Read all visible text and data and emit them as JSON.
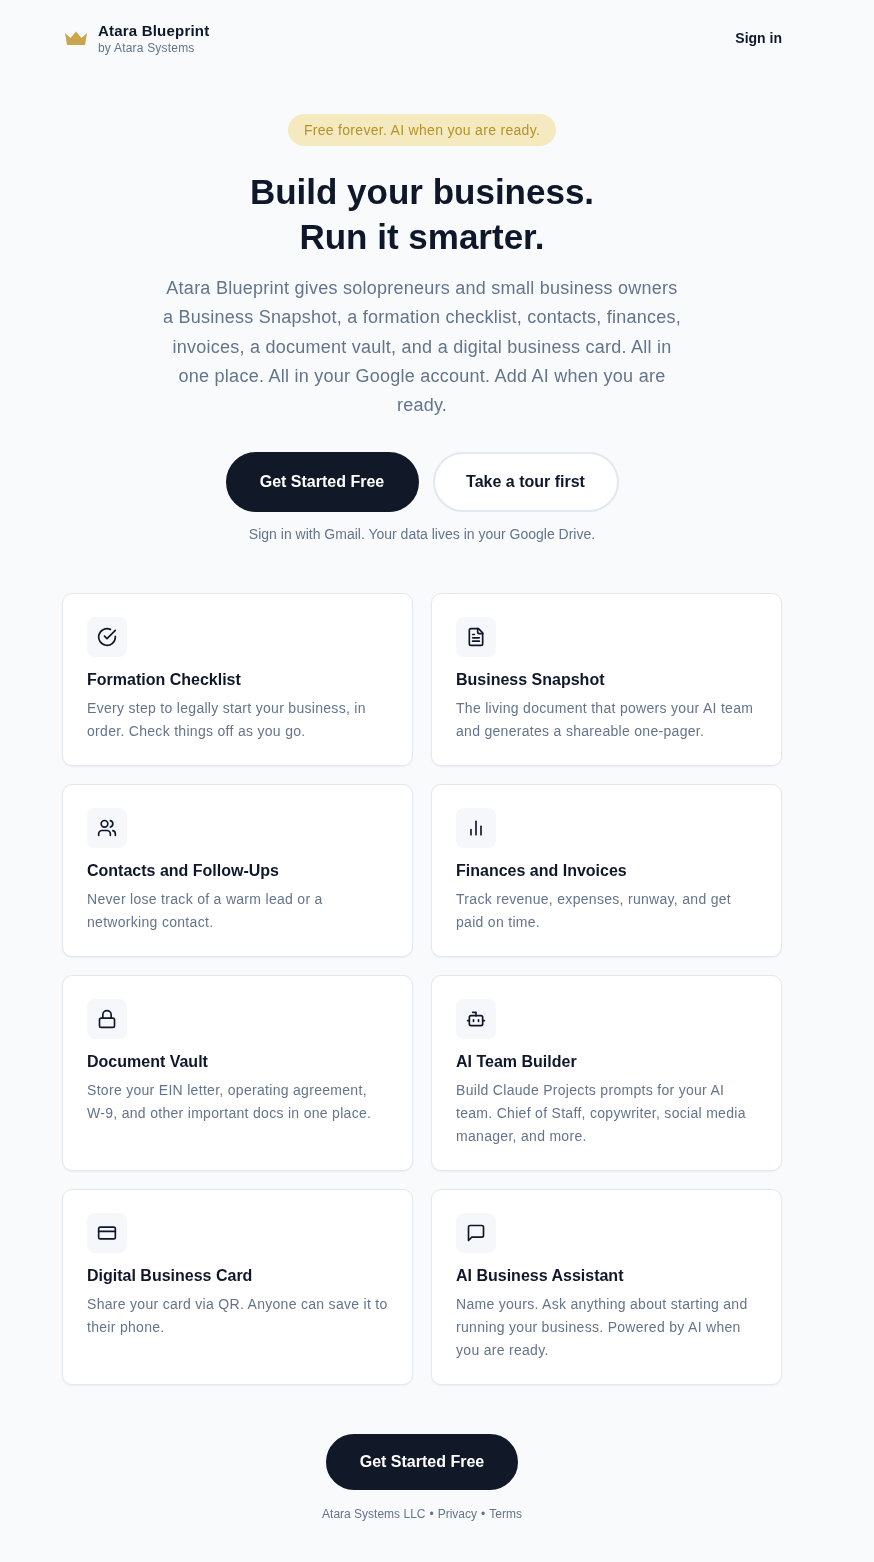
{
  "header": {
    "brand": {
      "name": "Atara Blueprint",
      "byline": "by Atara Systems"
    },
    "sign_in": "Sign in"
  },
  "hero": {
    "badge": "Free forever. AI when you are ready.",
    "title_lines": [
      "Build your business.",
      "Run it smarter."
    ],
    "description": "Atara Blueprint gives solopreneurs and small business owners a Business Snapshot, a formation checklist, contacts, finances, invoices, a document vault, and a digital business card. All in one place. All in your Google account. Add AI when you are ready.",
    "buttons": [
      {
        "label": "Get Started Free",
        "kind": "primary"
      },
      {
        "label": "Take a tour first",
        "kind": "secondary"
      }
    ],
    "note": "Sign in with Gmail. Your data lives in your Google Drive."
  },
  "features": [
    {
      "title": "Formation Checklist",
      "description": "Every step to legally start your business, in order. Check things off as you go."
    },
    {
      "title": "Business Snapshot",
      "description": "The living document that powers your AI team and generates a shareable one-pager."
    },
    {
      "title": "Contacts and Follow-Ups",
      "description": "Never lose track of a warm lead or a networking contact."
    },
    {
      "title": "Finances and Invoices",
      "description": "Track revenue, expenses, runway, and get paid on time."
    },
    {
      "title": "Document Vault",
      "description": "Store your EIN letter, operating agreement, W-9, and other important docs in one place."
    },
    {
      "title": "AI Team Builder",
      "description": "Build Claude Projects prompts for your AI team. Chief of Staff, copywriter, social media manager, and more."
    },
    {
      "title": "Digital Business Card",
      "description": "Share your card via QR. Anyone can save it to their phone."
    },
    {
      "title": "AI Business Assistant",
      "description": "Name yours. Ask anything about starting and running your business. Powered by AI when you are ready."
    }
  ],
  "cta": {
    "label": "Get Started Free",
    "kind": "primary"
  },
  "footer": {
    "company": "Atara Systems LLC",
    "links": [
      {
        "separator": "•",
        "label": "Privacy"
      },
      {
        "separator": "•",
        "label": "Terms"
      }
    ]
  }
}
